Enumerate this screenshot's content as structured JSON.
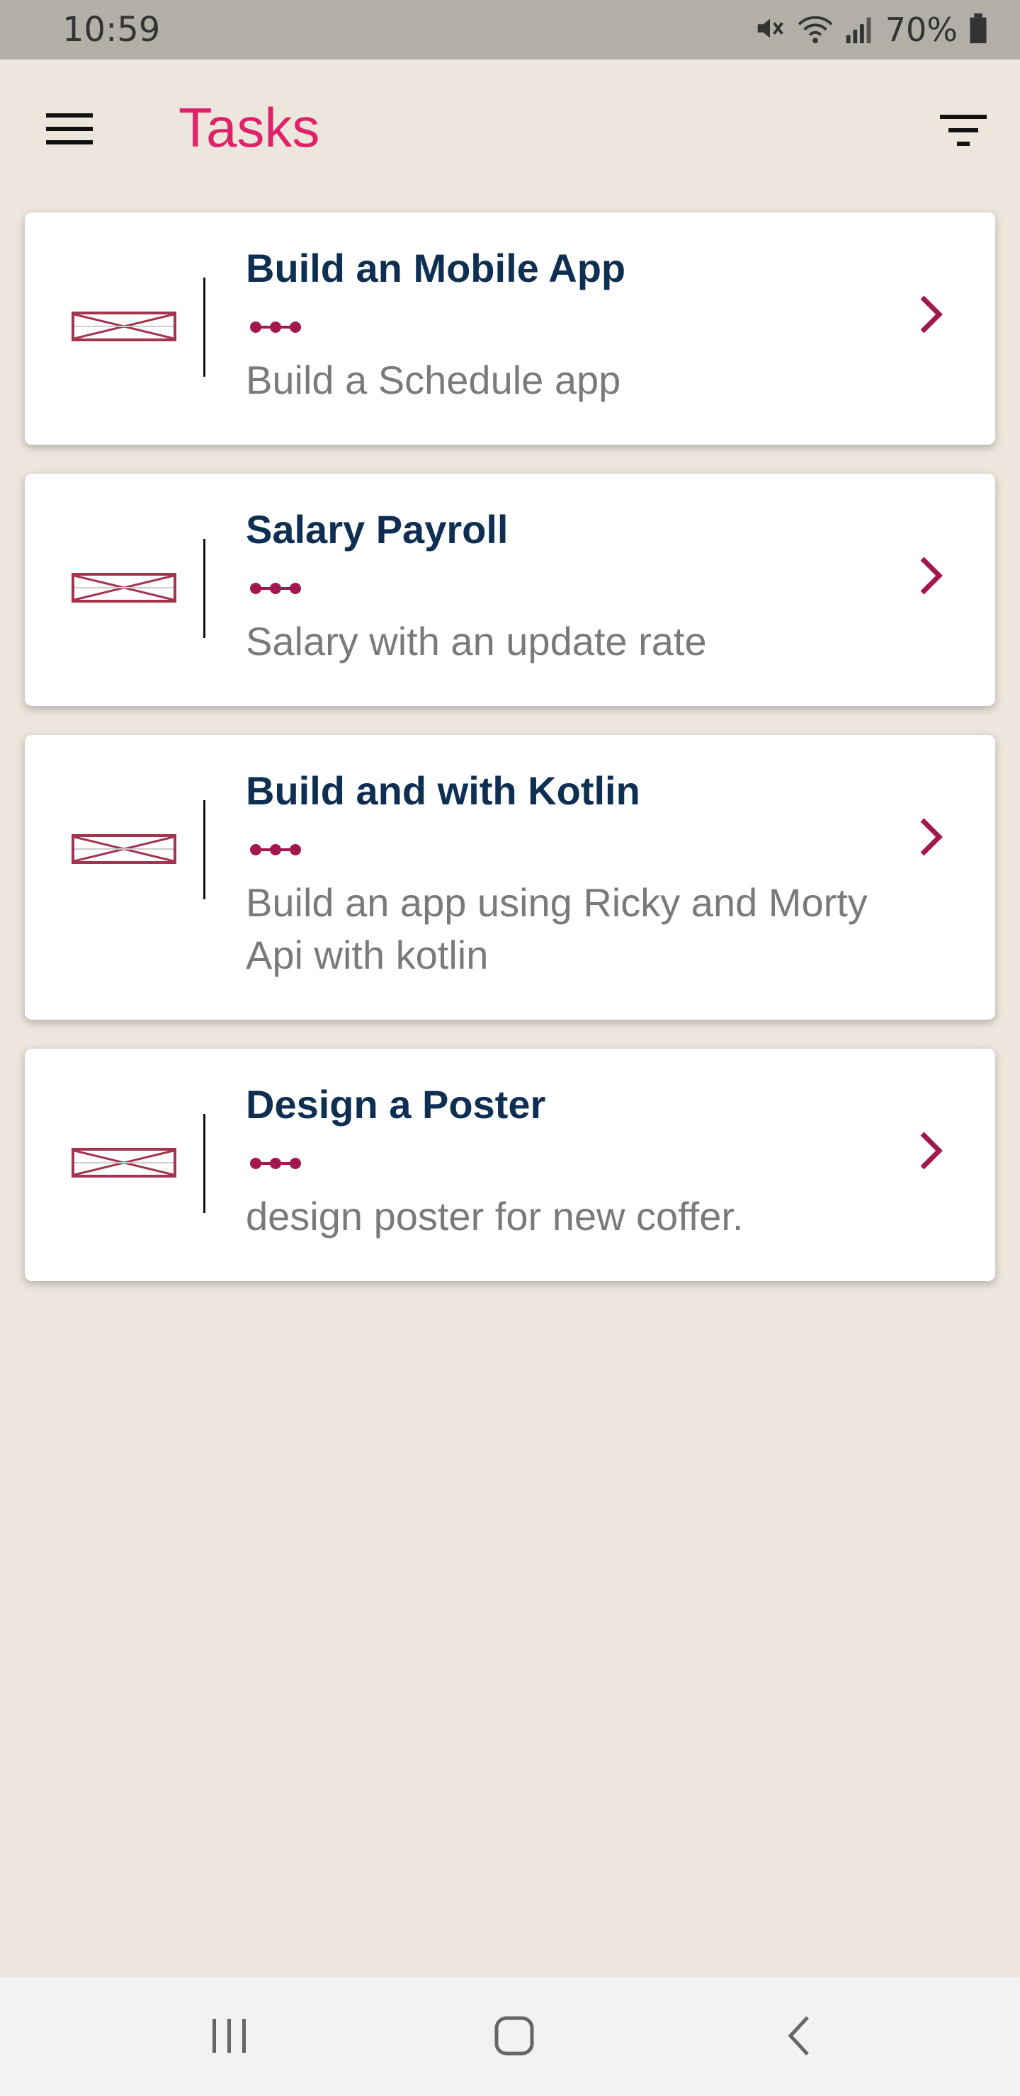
{
  "status_bar": {
    "time": "10:59",
    "battery_percent": "70%",
    "icons": [
      "mute-icon",
      "wifi-icon",
      "signal-icon",
      "battery-icon"
    ]
  },
  "app_bar": {
    "title": "Tasks",
    "title_color": "#e0226a",
    "menu_icon": "hamburger-menu-icon",
    "filter_icon": "filter-icon"
  },
  "tasks": [
    {
      "title": "Build an Mobile App",
      "description": "Build a Schedule app"
    },
    {
      "title": "Salary Payroll",
      "description": "Salary with an update rate"
    },
    {
      "title": "Build and with Kotlin",
      "description": "Build an app using Ricky and Morty Api with kotlin"
    },
    {
      "title": "Design a Poster",
      "description": "design poster for new coffer."
    }
  ],
  "colors": {
    "accent": "#e0226a",
    "title_text": "#0e2f52",
    "dots": "#a3174f",
    "thumb": "#a3344f",
    "background": "#ece6dc"
  },
  "nav_bar": {
    "icons": [
      "recent-apps-icon",
      "home-icon",
      "back-icon"
    ]
  }
}
